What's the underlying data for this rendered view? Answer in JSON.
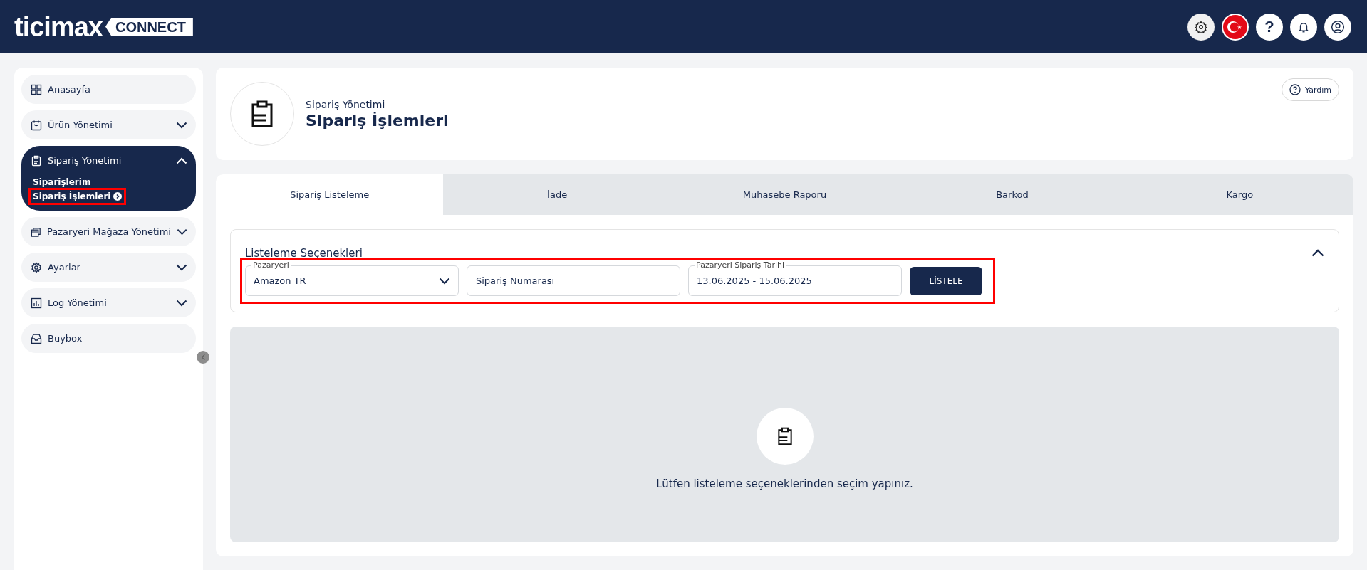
{
  "header": {
    "logo_text": "ticimax",
    "logo_badge": "CONNECT",
    "help_symbol": "?"
  },
  "sidebar": {
    "items": [
      {
        "label": "Anasayfa",
        "expandable": false,
        "expanded": false
      },
      {
        "label": "Ürün Yönetimi",
        "expandable": true,
        "expanded": false
      },
      {
        "label": "Sipariş Yönetimi",
        "expandable": true,
        "expanded": true,
        "children": [
          {
            "label": "Siparişlerim",
            "selected": false,
            "highlighted": false
          },
          {
            "label": "Sipariş İşlemleri",
            "selected": true,
            "highlighted": true
          }
        ]
      },
      {
        "label": "Pazaryeri Mağaza Yönetimi",
        "expandable": true,
        "expanded": false
      },
      {
        "label": "Ayarlar",
        "expandable": true,
        "expanded": false
      },
      {
        "label": "Log Yönetimi",
        "expandable": true,
        "expanded": false
      },
      {
        "label": "Buybox",
        "expandable": false,
        "expanded": false
      }
    ]
  },
  "page_header": {
    "breadcrumb": "Sipariş Yönetimi",
    "title": "Sipariş İşlemleri",
    "help_button": "Yardım"
  },
  "tabs": [
    {
      "label": "Sipariş Listeleme",
      "selected": true
    },
    {
      "label": "İade",
      "selected": false
    },
    {
      "label": "Muhasebe Raporu",
      "selected": false
    },
    {
      "label": "Barkod",
      "selected": false
    },
    {
      "label": "Kargo",
      "selected": false
    }
  ],
  "filter_panel": {
    "title": "Listeleme Seçenekleri",
    "expanded": true,
    "highlighted": true,
    "marketplace": {
      "label": "Pazaryeri",
      "value": "Amazon TR"
    },
    "order_number": {
      "placeholder": "Sipariş Numarası"
    },
    "date_range": {
      "label": "Pazaryeri Sipariş Tarihi",
      "value": "13.06.2025 - 15.06.2025"
    },
    "list_button": "LİSTELE"
  },
  "empty_state": {
    "message": "Lütfen listeleme seçeneklerinden seçim yapınız."
  }
}
